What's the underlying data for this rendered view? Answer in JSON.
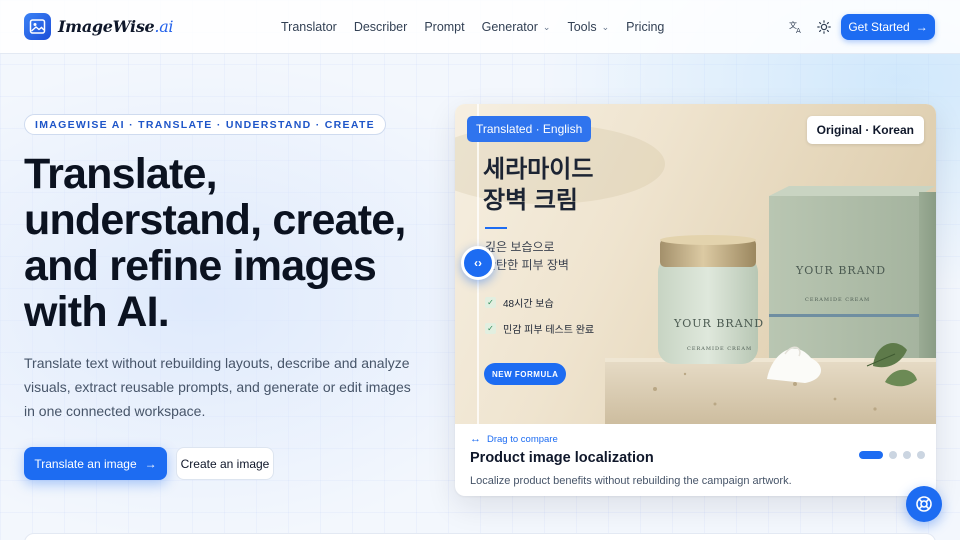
{
  "brand": {
    "name": "ImageWise",
    "suffix": ".ai"
  },
  "nav": {
    "items": [
      {
        "label": "Translator",
        "dropdown": false
      },
      {
        "label": "Describer",
        "dropdown": false
      },
      {
        "label": "Prompt",
        "dropdown": false
      },
      {
        "label": "Generator",
        "dropdown": true
      },
      {
        "label": "Tools",
        "dropdown": true
      },
      {
        "label": "Pricing",
        "dropdown": false
      }
    ],
    "icons": [
      "translate-icon",
      "sun-icon"
    ],
    "cta_label": "Get Started"
  },
  "hero": {
    "eyebrow": "IMAGEWISE AI · TRANSLATE · UNDERSTAND · CREATE",
    "headline_lines": [
      "Translate,",
      "understand, create,",
      "and refine images",
      "with AI."
    ],
    "subtext": "Translate text without rebuilding layouts, describe and analyze visuals, extract reusable prompts, and generate or edit images in one connected workspace.",
    "primary_button": "Translate an image",
    "secondary_button": "Create an image"
  },
  "showcase": {
    "translated_pill": "Translated · English",
    "original_pill": "Original · Korean",
    "image_text": {
      "title_line1": "세라마이드",
      "title_line2": "장벽 크림",
      "sub_line1": "깊은 보습으로",
      "sub_line2": "탄탄한 피부 장벽",
      "checks": [
        "48시간 보습",
        "민감 피부 테스트 완료"
      ],
      "badge": "NEW FORMULA",
      "box_brand": "YOUR BRAND",
      "box_sub": "CERAMIDE CREAM",
      "jar_brand": "YOUR BRAND",
      "jar_sub": "CERAMIDE CREAM"
    },
    "drag_hint": "Drag to compare",
    "title": "Product image localization",
    "description": "Localize product benefits without rebuilding the campaign artwork.",
    "slides_total": 4,
    "active_slide": 1
  },
  "colors": {
    "accent": "#1d6cf2",
    "text": "#0f172a",
    "muted": "#475569"
  }
}
